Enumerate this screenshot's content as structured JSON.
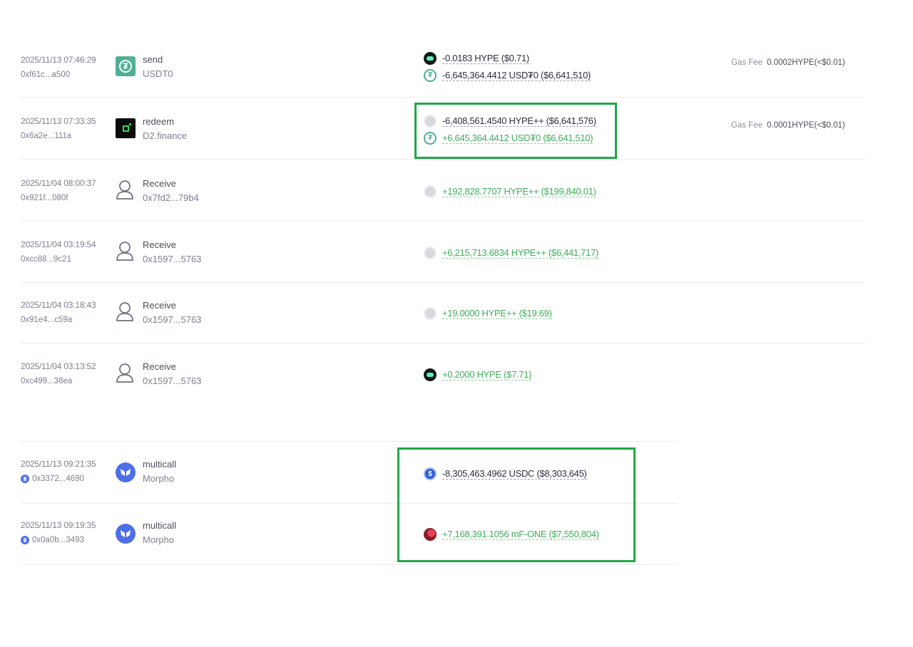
{
  "transactions_hyperevm": [
    {
      "time": "2025/11/13 07:46:29",
      "hash": "0xf61c...a500",
      "protocol_icon": "usdt0-logo",
      "action": "send",
      "target": "USDT0",
      "changes": [
        {
          "token_icon": "hype-token-icon",
          "direction": "out",
          "text": "-0.0183 HYPE ($0.71)"
        },
        {
          "token_icon": "usdt0-token-icon",
          "direction": "out",
          "text": "-6,645,364.4412 USD₮0 ($6,641,510)"
        }
      ],
      "gas_label": "Gas Fee",
      "gas_value": "0.0002HYPE(<$0.01)"
    },
    {
      "time": "2025/11/13 07:33:35",
      "hash": "0x6a2e...111a",
      "protocol_icon": "d2-finance-logo",
      "action": "redeem",
      "target": "D2.finance",
      "changes": [
        {
          "token_icon": "hypepp-token-icon",
          "direction": "out",
          "text": "-6,408,561.4540 HYPE++ ($6,641,576)"
        },
        {
          "token_icon": "usdt0-token-icon",
          "direction": "in",
          "text": "+6,645,364.4412 USD₮0 ($6,641,510)"
        }
      ],
      "gas_label": "Gas Fee",
      "gas_value": "0.0001HYPE(<$0.01)"
    },
    {
      "time": "2025/11/04 08:00:37",
      "hash": "0x921f...080f",
      "protocol_icon": "person-icon",
      "action": "Receive",
      "target": "0x7fd2...79b4",
      "changes": [
        {
          "token_icon": "hypepp-token-icon",
          "direction": "in",
          "text": "+192,828.7707 HYPE++ ($199,840.01)"
        }
      ]
    },
    {
      "time": "2025/11/04 03:19:54",
      "hash": "0xcc88...9c21",
      "protocol_icon": "person-icon",
      "action": "Receive",
      "target": "0x1597...5763",
      "changes": [
        {
          "token_icon": "hypepp-token-icon",
          "direction": "in",
          "text": "+6,215,713.6834 HYPE++ ($6,441,717)"
        }
      ]
    },
    {
      "time": "2025/11/04 03:18:43",
      "hash": "0x91e4...c59a",
      "protocol_icon": "person-icon",
      "action": "Receive",
      "target": "0x1597...5763",
      "changes": [
        {
          "token_icon": "hypepp-token-icon",
          "direction": "in",
          "text": "+19.0000 HYPE++ ($19.69)"
        }
      ]
    },
    {
      "time": "2025/11/04 03:13:52",
      "hash": "0xc499...38ea",
      "protocol_icon": "person-icon",
      "action": "Receive",
      "target": "0x1597...5763",
      "changes": [
        {
          "token_icon": "hype-token-icon",
          "direction": "in",
          "text": "+0.2000 HYPE ($7.71)"
        }
      ]
    }
  ],
  "transactions_morpho": [
    {
      "time": "2025/11/13 09:21:35",
      "hash": "0x3372...4690",
      "chain_icon": "ethereum-chain-icon",
      "protocol_icon": "morpho-logo",
      "action": "multicall",
      "target": "Morpho",
      "changes": [
        {
          "token_icon": "usdc-token-icon",
          "direction": "out",
          "text": "-8,305,463.4962 USDC ($8,303,645)"
        }
      ]
    },
    {
      "time": "2025/11/13 09:19:35",
      "hash": "0x0a0b...3493",
      "chain_icon": "ethereum-chain-icon",
      "protocol_icon": "morpho-logo",
      "action": "multicall",
      "target": "Morpho",
      "changes": [
        {
          "token_icon": "mf-one-token-icon",
          "direction": "in",
          "text": "+7,168,391.1056 mF-ONE ($7,550,804)"
        }
      ]
    }
  ],
  "colors": {
    "incoming": "#3fae5a",
    "outgoing": "#2c3140",
    "highlight_box": "#1fa847"
  }
}
